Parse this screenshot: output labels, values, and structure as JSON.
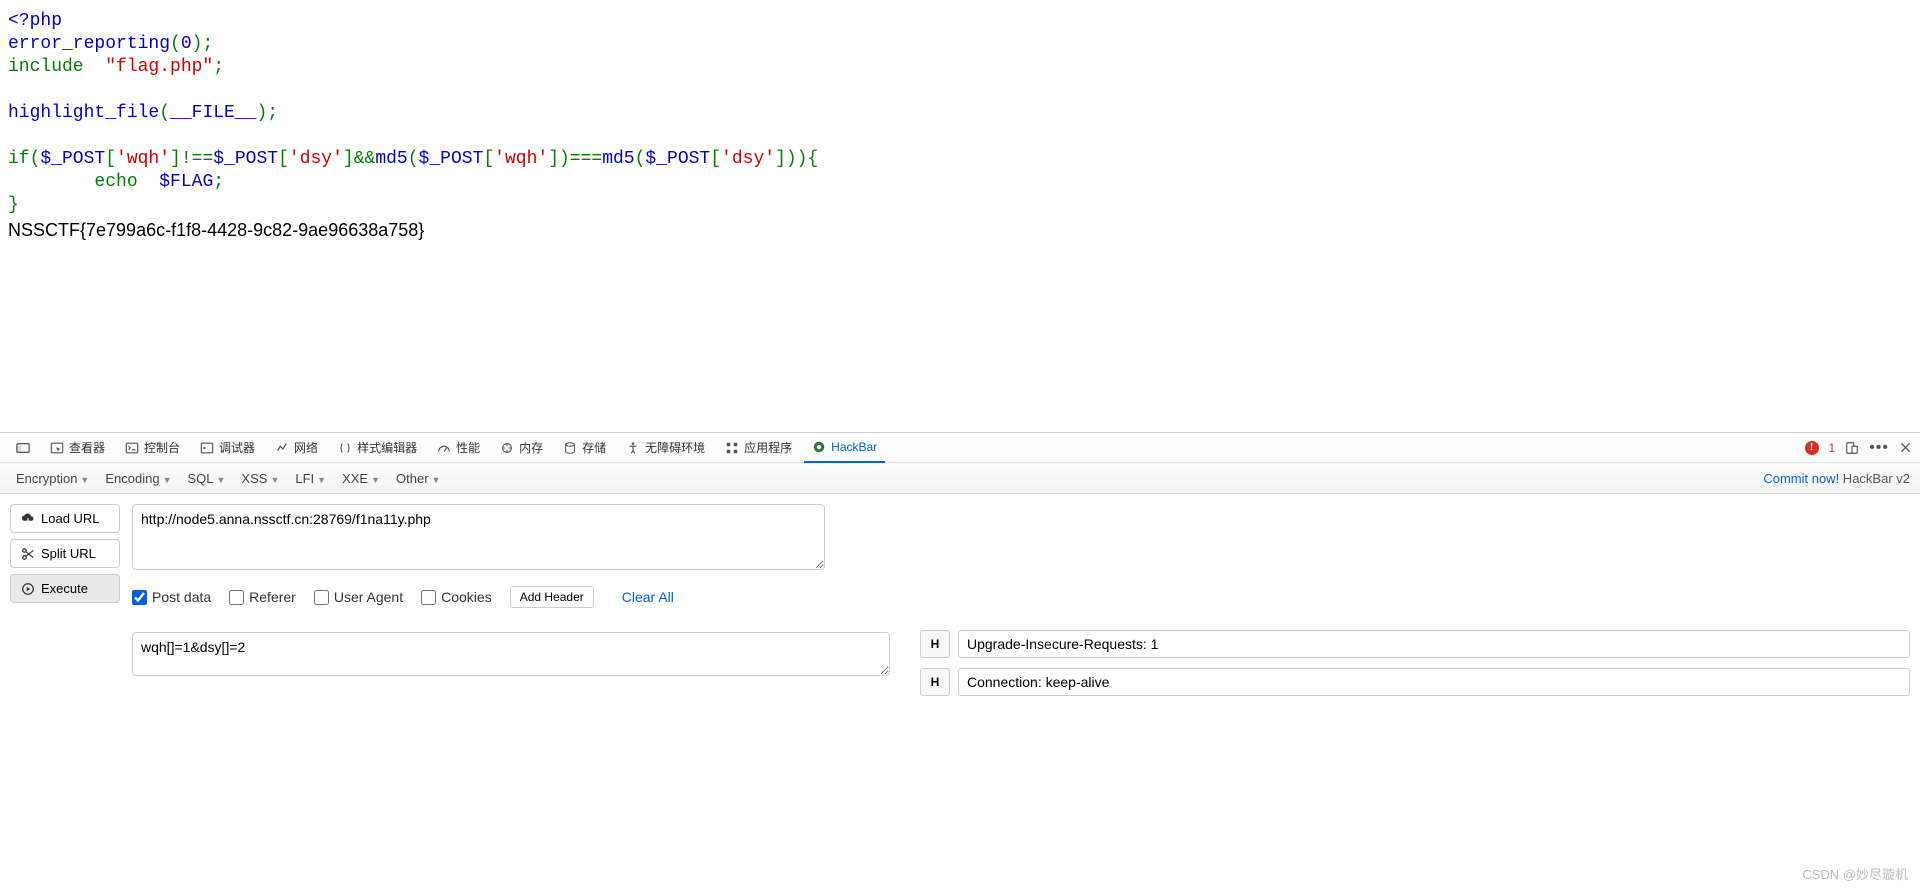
{
  "code": {
    "open_tag": "<?php",
    "err_reporting": "error_reporting",
    "zero": "0",
    "include": "include  ",
    "flag_php": "\"flag.php\"",
    "highlight": "highlight_file",
    "file_const": "__FILE__",
    "if_kw": "if(",
    "post1": "$_POST",
    "wqh": "'wqh'",
    "neq": "!==",
    "dsy": "'dsy'",
    "andand": "&&",
    "md5fn": "md5",
    "eqeqeq": "===",
    "brace_open": "{",
    "echo": "        echo  ",
    "flagvar": "$FLAG",
    "brace_close": "}",
    "semi": ";"
  },
  "flag_output": "NSSCTF{7e799a6c-f1f8-4428-9c82-9ae96638a758}",
  "devtools": {
    "tabs": {
      "inspector": "查看器",
      "console": "控制台",
      "debugger": "调试器",
      "network": "网络",
      "styleeditor": "样式编辑器",
      "performance": "性能",
      "memory": "内存",
      "storage": "存储",
      "accessibility": "无障碍环境",
      "application": "应用程序",
      "hackbar": "HackBar"
    },
    "error_count": "1"
  },
  "hackbar": {
    "menus": [
      "Encryption",
      "Encoding",
      "SQL",
      "XSS",
      "LFI",
      "XXE",
      "Other"
    ],
    "commit": "Commit now!",
    "brand": " HackBar v2",
    "buttons": {
      "load": "Load URL",
      "split": "Split URL",
      "execute": "Execute"
    },
    "url": "http://node5.anna.nssctf.cn:28769/f1na11y.php",
    "checks": {
      "post": "Post data",
      "referer": "Referer",
      "ua": "User Agent",
      "cookies": "Cookies"
    },
    "add_header": "Add Header",
    "clear_all": "Clear All",
    "post_value": "wqh[]=1&dsy[]=2",
    "headers": [
      "Upgrade-Insecure-Requests: 1",
      "Connection: keep-alive"
    ],
    "header_btn": "H"
  },
  "watermark": "CSDN @妙尽璇机"
}
